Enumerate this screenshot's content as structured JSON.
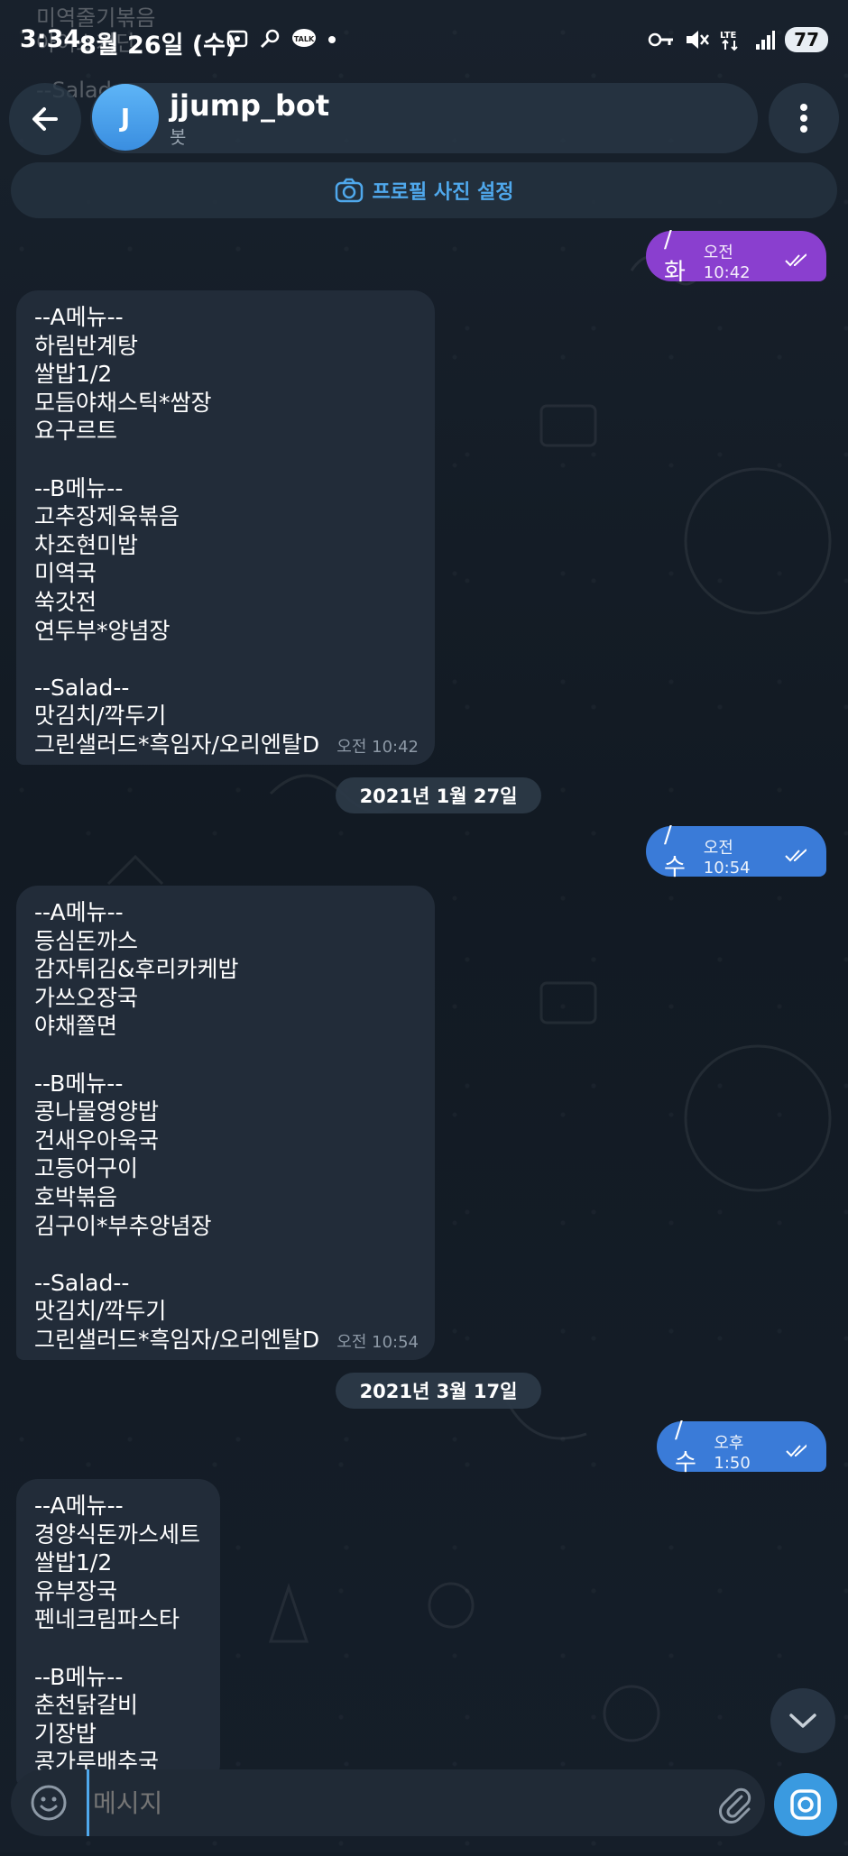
{
  "status_bar": {
    "time": "3:34",
    "date": "8월 26일 (수)",
    "battery": "77",
    "network": "LTE"
  },
  "ghost_text": [
    "미역줄기볶음",
    "아이스겨단",
    "--Salad--"
  ],
  "header": {
    "avatar_letter": "J",
    "title": "jjump_bot",
    "subtitle": "봇"
  },
  "profile_bar": {
    "label": "프로필 사진 설정"
  },
  "messages": [
    {
      "type": "out",
      "text": "/화",
      "time": "오전 10:42",
      "color": "#8a3fcf"
    },
    {
      "type": "in",
      "time": "오전 10:42",
      "lines": [
        "--A메뉴--",
        "하림반계탕",
        "쌀밥1/2",
        "모듬야채스틱*쌈장",
        "요구르트",
        "",
        "--B메뉴--",
        "고추장제육볶음",
        "차조현미밥",
        "미역국",
        "쑥갓전",
        "연두부*양념장",
        "",
        "--Salad--",
        "맛김치/깍두기",
        "그린샐러드*흑임자/오리엔탈D"
      ]
    },
    {
      "type": "date",
      "text": "2021년 1월 27일"
    },
    {
      "type": "out",
      "text": "/수",
      "time": "오전 10:54",
      "color": "#3a7bd8"
    },
    {
      "type": "in",
      "time": "오전 10:54",
      "lines": [
        "--A메뉴--",
        "등심돈까스",
        "감자튀김&후리카케밥",
        "가쓰오장국",
        "야채쫄면",
        "",
        "--B메뉴--",
        "콩나물영양밥",
        "건새우아욱국",
        "고등어구이",
        "호박볶음",
        "김구이*부추양념장",
        "",
        "--Salad--",
        "맛김치/깍두기",
        "그린샐러드*흑임자/오리엔탈D"
      ]
    },
    {
      "type": "date",
      "text": "2021년 3월 17일"
    },
    {
      "type": "out",
      "text": "/수",
      "time": "오후 1:50",
      "color": "#3a7bd8"
    },
    {
      "type": "in",
      "time": "",
      "lines": [
        "--A메뉴--",
        "경양식돈까스세트",
        "쌀밥1/2",
        "유부장국",
        "펜네크림파스타",
        "",
        "--B메뉴--",
        "춘천닭갈비",
        "기장밥",
        "콩가루배추국"
      ]
    }
  ],
  "input": {
    "placeholder": "메시지"
  },
  "icons": {
    "back": "arrow-left-icon",
    "menu": "more-vertical-icon",
    "profile_camera": "camera-icon",
    "emoji": "smile-icon",
    "attach": "paperclip-icon",
    "send_camera": "camera-icon",
    "scroll_down": "chevron-down-icon",
    "read_ticks": "double-check-icon"
  },
  "colors": {
    "accent": "#4fa8ec",
    "incoming_bubble": "#222c39",
    "outgoing_purple": "#8a3fcf",
    "outgoing_blue": "#3a7bd8"
  }
}
